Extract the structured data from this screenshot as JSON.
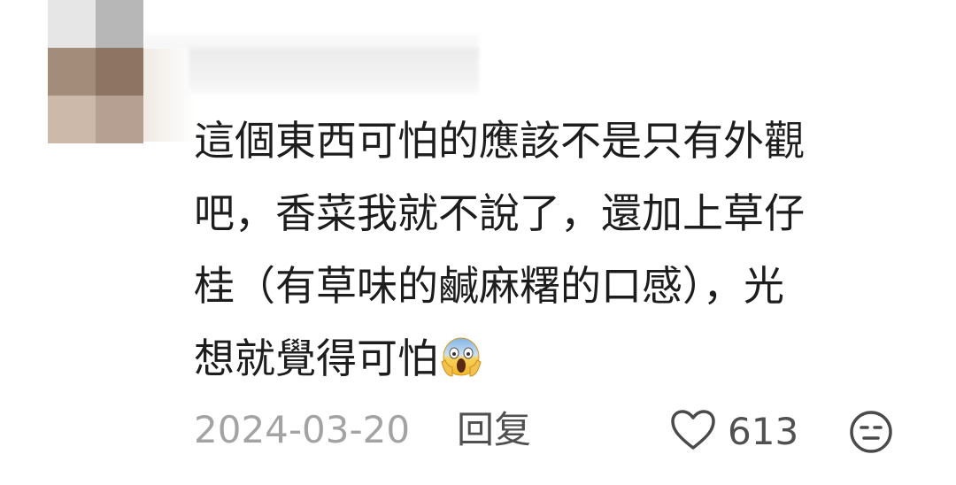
{
  "comment": {
    "avatar_icon": "pixelated-avatar",
    "username": "",
    "lines": [
      "這個東西可怕的應該不是只有外觀",
      "吧，香菜我就不說了，還加上草仔",
      "桂（有草味的鹹麻糬的口感），光",
      "想就覺得可怕"
    ],
    "emoji": "screaming-face-emoji",
    "date": "2024-03-20",
    "reply_label": "回复",
    "like_icon": "heart-outline-icon",
    "like_count": "613",
    "dislike_icon": "unamused-face-icon"
  },
  "colors": {
    "text": "#1d1d1d",
    "meta": "#a3a3a3",
    "action": "#505050"
  }
}
